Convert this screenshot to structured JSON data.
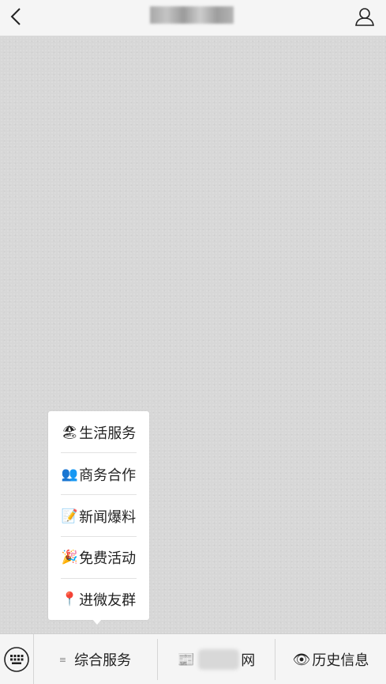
{
  "header": {
    "back_icon": "chevron-left-icon",
    "profile_icon": "person-icon"
  },
  "popup_menu": {
    "items": [
      {
        "emoji": "🏖",
        "label": "生活服务"
      },
      {
        "emoji": "👥",
        "label": "商务合作"
      },
      {
        "emoji": "📝",
        "label": "新闻爆料"
      },
      {
        "emoji": "🎉",
        "label": "免费活动"
      },
      {
        "emoji": "📍",
        "label": "进微友群"
      }
    ]
  },
  "bottom_bar": {
    "keyboard_icon": "keyboard-icon",
    "tabs": [
      {
        "prefix": "≡",
        "label": "综合服务"
      },
      {
        "prefix": "📰",
        "label": "网"
      },
      {
        "prefix": "👁",
        "label": "历史信息"
      }
    ]
  }
}
